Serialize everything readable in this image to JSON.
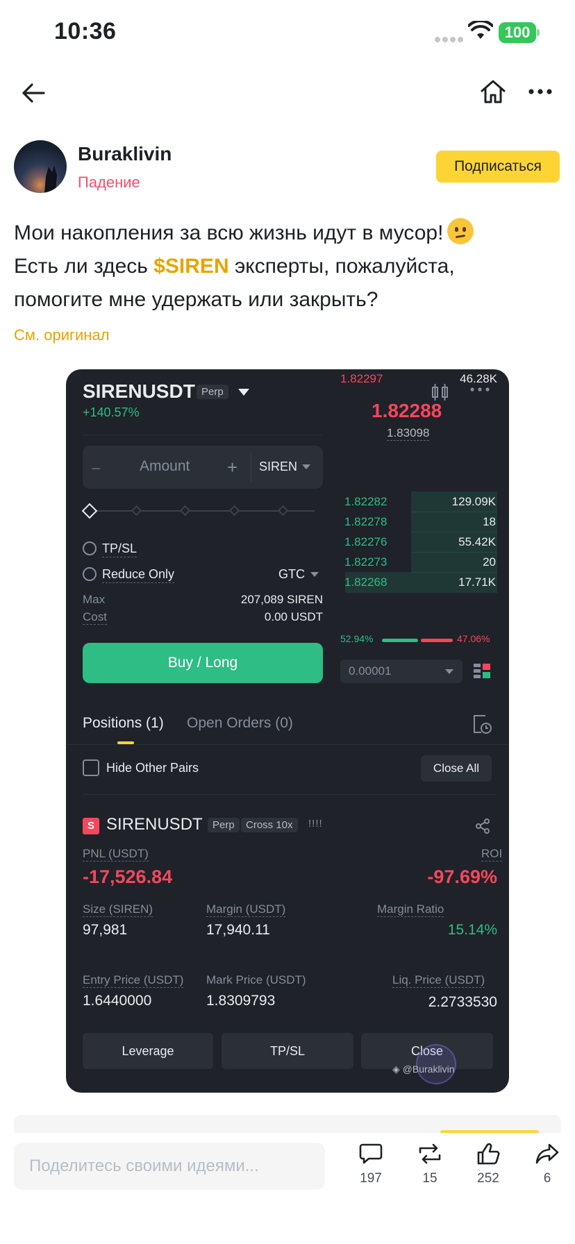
{
  "status_bar": {
    "time": "10:36",
    "battery": "100"
  },
  "author": {
    "name": "Buraklivin",
    "subtitle": "Падение",
    "follow_label": "Подписаться"
  },
  "post": {
    "line1": "Мои накопления за всю жизнь идут в мусор!",
    "line2_before": "Есть ли здесь ",
    "ticker": "$SIREN",
    "line2_after": " эксперты, пожалуйста,",
    "line3": "помогите мне удержать или закрыть?",
    "see_original": "См. оригинал"
  },
  "screenshot": {
    "symbol": "SIRENUSDT",
    "perp_tag": "Perp",
    "change": "+140.57%",
    "order_form": {
      "amount_placeholder": "Amount",
      "minus": "−",
      "plus": "+",
      "unit": "SIREN",
      "tpsl_label": "TP/SL",
      "reduce_only_label": "Reduce Only",
      "tif": "GTC",
      "max_label": "Max",
      "max_value": "207,089 SIREN",
      "cost_label": "Cost",
      "cost_value": "0.00 USDT",
      "buy_label": "Buy / Long"
    },
    "orderbook": {
      "top_price": "1.82297",
      "top_qty": "46.28K",
      "last_price": "1.82288",
      "mark_price": "1.83098",
      "bids": [
        {
          "price": "1.82282",
          "qty": "129.09K",
          "depth": 0.55
        },
        {
          "price": "1.82278",
          "qty": "18",
          "depth": 0.55
        },
        {
          "price": "1.82276",
          "qty": "55.42K",
          "depth": 0.55
        },
        {
          "price": "1.82273",
          "qty": "20",
          "depth": 0.55
        },
        {
          "price": "1.82268",
          "qty": "17.71K",
          "depth": 0.97
        }
      ],
      "buy_ratio": "52.94%",
      "sell_ratio": "47.06%",
      "tick_size": "0.00001"
    },
    "tabs": {
      "positions": "Positions (1)",
      "open_orders": "Open Orders (0)"
    },
    "hide_other_pairs": "Hide Other Pairs",
    "close_all": "Close All",
    "position": {
      "side_badge": "S",
      "symbol": "SIRENUSDT",
      "perp_tag": "Perp",
      "margin_tag": "Cross 10x",
      "bars": "!!!!",
      "pnl_label": "PNL (USDT)",
      "pnl": "-17,526.84",
      "roi_label": "ROI",
      "roi": "-97.69%",
      "size_label": "Size (SIREN)",
      "size": "97,981",
      "margin_label": "Margin (USDT)",
      "margin": "17,940.11",
      "margin_ratio_label": "Margin Ratio",
      "margin_ratio": "15.14%",
      "entry_label": "Entry Price (USDT)",
      "entry": "1.6440000",
      "mark_label": "Mark Price (USDT)",
      "mark": "1.8309793",
      "liq_label": "Liq. Price (USDT)",
      "liq": "2.2733530",
      "btn_leverage": "Leverage",
      "btn_tpsl": "TP/SL",
      "btn_close": "Close"
    },
    "watermark": "@Buraklivin"
  },
  "bottom": {
    "reply_placeholder": "Поделитесь своими идеями...",
    "comments": "197",
    "reposts": "15",
    "likes": "252",
    "shares": "6"
  },
  "colors": {
    "accent": "#fcd535",
    "down": "#f6465d",
    "up": "#2ebd85",
    "ticker": "#e8a400"
  }
}
